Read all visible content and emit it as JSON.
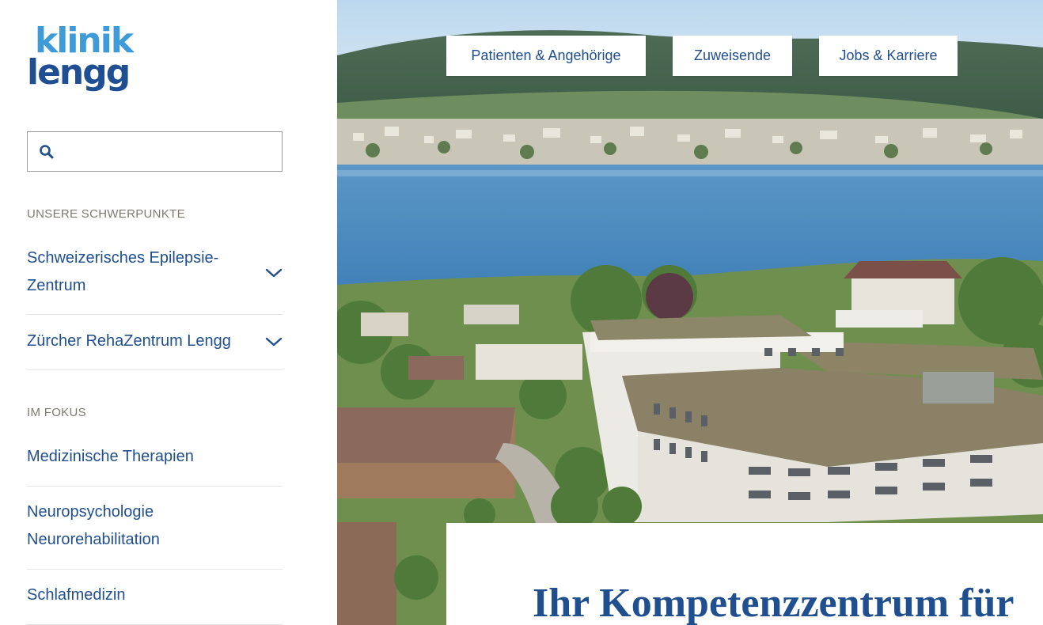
{
  "logo": {
    "line1": "klinik",
    "line2": "lengg"
  },
  "search": {
    "placeholder": "",
    "value": ""
  },
  "sidebar": {
    "section_focus": "UNSERE SCHWERPUNKTE",
    "focus_items": [
      {
        "label": "Schweizerisches Epilepsie-Zentrum",
        "icon": "chevron-down-icon"
      },
      {
        "label": "Zürcher RehaZentrum Lengg",
        "icon": "chevron-down-icon"
      }
    ],
    "section_highlights": "IM FOKUS",
    "highlight_items": [
      {
        "label": "Medizinische Therapien"
      },
      {
        "label": "Neuropsychologie Neurorehabilitation"
      },
      {
        "label": "Schlafmedizin"
      }
    ]
  },
  "topnav": {
    "items": [
      {
        "label": "Patienten & Angehörige"
      },
      {
        "label": "Zuweisende"
      },
      {
        "label": "Jobs & Karriere"
      }
    ]
  },
  "hero": {
    "title": "Ihr Kompetenzzentrum für"
  },
  "colors": {
    "brand_blue": "#1f4f8f",
    "logo_light_blue": "#3f9ad8",
    "label_grey": "#7d7a6f",
    "divider": "#e4e4e4"
  }
}
